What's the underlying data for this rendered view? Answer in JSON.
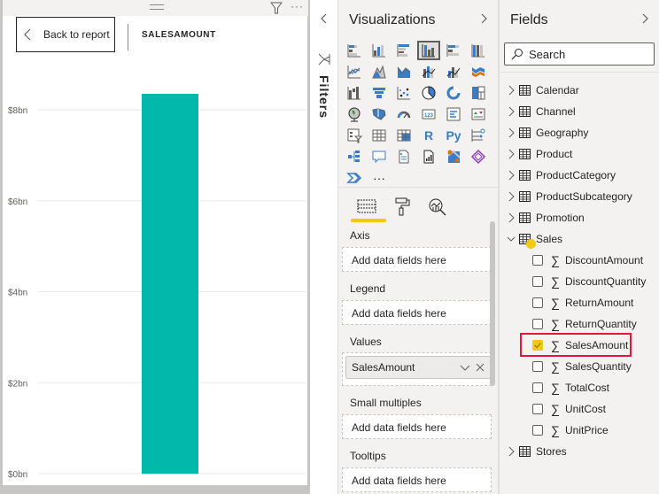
{
  "report": {
    "back_label": "Back to report",
    "visual_title": "SALESAMOUNT",
    "more_label": "···"
  },
  "chart_data": {
    "type": "bar",
    "title": "SALESAMOUNT",
    "categories": [
      ""
    ],
    "values": [
      8.35
    ],
    "value_unit": "$bn",
    "xlabel": "",
    "ylabel": "",
    "ylim": [
      0,
      8.5
    ],
    "yticks": [
      0,
      2,
      4,
      6,
      8
    ],
    "ytick_labels": [
      "$0bn",
      "$2bn",
      "$4bn",
      "$6bn",
      "$8bn"
    ],
    "grid": true,
    "bar_color": "#01b8aa"
  },
  "filters": {
    "label": "Filters"
  },
  "visualizations": {
    "title": "Visualizations",
    "icons": [
      [
        "stacked-bar-chart",
        "stacked-column-chart",
        "clustered-bar-chart",
        "clustered-column-chart",
        "100-stacked-bar-chart",
        "100-stacked-column-chart"
      ],
      [
        "line-chart",
        "area-chart",
        "stacked-area-chart",
        "line-and-stacked-column-chart",
        "line-and-clustered-column-chart",
        "ribbon-chart"
      ],
      [
        "waterfall-chart",
        "funnel-chart",
        "scatter-chart",
        "pie-chart",
        "donut-chart",
        "treemap"
      ],
      [
        "map",
        "filled-map",
        "gauge",
        "card",
        "multi-row-card",
        "kpi"
      ],
      [
        "slicer",
        "table",
        "matrix",
        "r-visual",
        "python-visual",
        "key-influencers"
      ],
      [
        "decomposition-tree",
        "q-and-a",
        "smart-narrative",
        "paginated-report",
        "arcgis-map",
        "power-apps"
      ],
      [
        "power-automate",
        "more-visuals"
      ]
    ],
    "selected_icon": "clustered-column-chart",
    "r_label": "R",
    "py_label": "Py",
    "more_label": "···",
    "subtabs": [
      "fields",
      "format",
      "analytics"
    ],
    "wells": {
      "axis": {
        "label": "Axis",
        "placeholder": "Add data fields here"
      },
      "legend": {
        "label": "Legend",
        "placeholder": "Add data fields here"
      },
      "values": {
        "label": "Values",
        "field": "SalesAmount"
      },
      "small_multiples": {
        "label": "Small multiples",
        "placeholder": "Add data fields here"
      },
      "tooltips": {
        "label": "Tooltips",
        "placeholder": "Add data fields here"
      }
    }
  },
  "fields": {
    "title": "Fields",
    "search_placeholder": "Search",
    "tables": [
      {
        "name": "Calendar",
        "expanded": false
      },
      {
        "name": "Channel",
        "expanded": false
      },
      {
        "name": "Geography",
        "expanded": false
      },
      {
        "name": "Product",
        "expanded": false
      },
      {
        "name": "ProductCategory",
        "expanded": false
      },
      {
        "name": "ProductSubcategory",
        "expanded": false
      },
      {
        "name": "Promotion",
        "expanded": false
      },
      {
        "name": "Sales",
        "expanded": true
      }
    ],
    "sales_fields": [
      {
        "name": "DiscountAmount",
        "checked": false
      },
      {
        "name": "DiscountQuantity",
        "checked": false
      },
      {
        "name": "ReturnAmount",
        "checked": false
      },
      {
        "name": "ReturnQuantity",
        "checked": false
      },
      {
        "name": "SalesAmount",
        "checked": true
      },
      {
        "name": "SalesQuantity",
        "checked": false
      },
      {
        "name": "TotalCost",
        "checked": false
      },
      {
        "name": "UnitCost",
        "checked": false
      },
      {
        "name": "UnitPrice",
        "checked": false
      }
    ],
    "after_tables": [
      {
        "name": "Stores",
        "expanded": false
      }
    ],
    "sigma": "∑"
  }
}
